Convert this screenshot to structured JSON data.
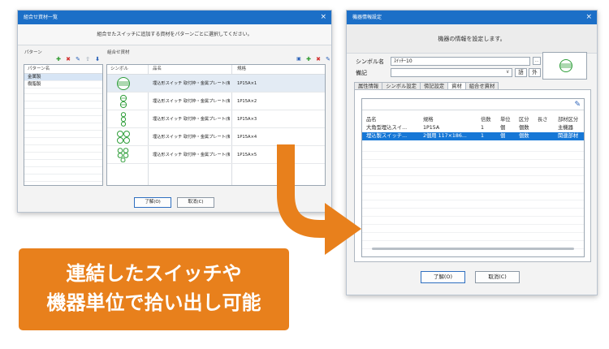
{
  "left_window": {
    "title": "組合せ資材一覧",
    "close_glyph": "×",
    "instruction": "組合せたスイッチに追加する資材をパターンごとに選択してください。",
    "pattern_panel_label": "パターン",
    "material_panel_label": "組合せ資材",
    "pattern_column_header": "パターン名",
    "patterns": [
      "金属製",
      "樹脂製"
    ],
    "columns": {
      "symbol": "シンボル",
      "name": "品名",
      "spec": "規格"
    },
    "rows": [
      {
        "name": "埋込形スイッチ 取付枠・金属プレート(新金属)",
        "spec": "1P15A×1",
        "symbol": "switch-1-gang"
      },
      {
        "name": "埋込形スイッチ 取付枠・金属プレート(新金属)",
        "spec": "1P15A×2",
        "symbol": "switch-2-gang"
      },
      {
        "name": "埋込形スイッチ 取付枠・金属プレート(新金属)",
        "spec": "1P15A×3",
        "symbol": "switch-3-gang"
      },
      {
        "name": "埋込形スイッチ 取付枠・金属プレート(新金属)",
        "spec": "1P15A×4",
        "symbol": "switch-4-gang"
      },
      {
        "name": "埋込形スイッチ 取付枠・金属プレート(新金属)",
        "spec": "1P15A×5",
        "symbol": "switch-5-gang"
      }
    ],
    "ok_button": "了解(O)",
    "cancel_button": "取消(C)"
  },
  "right_window": {
    "title": "機器情報設定",
    "close_glyph": "×",
    "instruction": "機器の情報を設定します。",
    "symbol_name_label": "シンボル名",
    "symbol_name_value": "ｽｲｯﾁｰ10",
    "note_label": "備記",
    "note_value": "",
    "dropdown_glyph": "∨",
    "btn_word": "語",
    "btn_outside": "外",
    "tabs": [
      "属性情報",
      "シンボル設定",
      "傍記設定",
      "資材",
      "組合せ資材"
    ],
    "active_tab": 3,
    "columns": {
      "name": "品名",
      "spec": "規格",
      "qty": "倍数",
      "unit": "単位",
      "category": "区分",
      "length": "長さ",
      "part_category": "部材区分"
    },
    "rows": [
      {
        "name": "大角型埋込スイ...",
        "spec": "1P15A",
        "qty": "1",
        "unit": "個",
        "category": "個数",
        "length": "",
        "part_category": "主機器"
      },
      {
        "name": "埋込製スイッチ...",
        "spec": "2個用 117×186...",
        "qty": "1",
        "unit": "個",
        "category": "個数",
        "length": "",
        "part_category": "関連部材"
      }
    ],
    "ok_button": "了解(O)",
    "cancel_button": "取消(C)"
  },
  "caption": {
    "line1": "連結したスイッチや",
    "line2": "機器単位で拾い出し可能"
  },
  "colors": {
    "titlebar": "#1c6fc7",
    "accent_orange": "#e8801c",
    "selection_blue": "#1677d6",
    "symbol_green": "#2f9e3a"
  }
}
